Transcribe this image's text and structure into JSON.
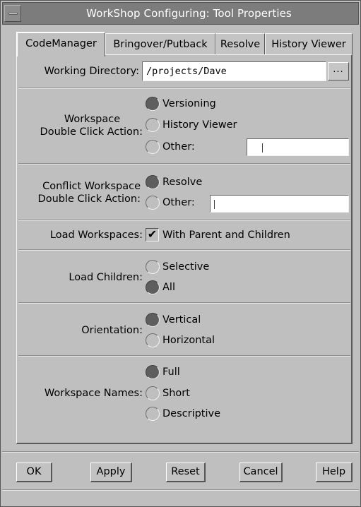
{
  "window": {
    "title": "WorkShop Configuring: Tool Properties"
  },
  "tabs": [
    {
      "label": "CodeManager",
      "active": true
    },
    {
      "label": "Bringover/Putback",
      "active": false
    },
    {
      "label": "Resolve",
      "active": false
    },
    {
      "label": "History Viewer",
      "active": false
    }
  ],
  "working_directory": {
    "label": "Working Directory:",
    "value": "/projects/Dave",
    "browse_label": "..."
  },
  "workspace_double_click": {
    "label_line1": "Workspace",
    "label_line2": "Double Click Action:",
    "options": [
      {
        "label": "Versioning",
        "selected": true
      },
      {
        "label": "History Viewer",
        "selected": false
      },
      {
        "label": "Other:",
        "selected": false
      }
    ],
    "other_value": ""
  },
  "conflict_double_click": {
    "label_line1": "Conflict Workspace",
    "label_line2": "Double Click Action:",
    "options": [
      {
        "label": "Resolve",
        "selected": true
      },
      {
        "label": "Other:",
        "selected": false
      }
    ],
    "other_value": ""
  },
  "load_workspaces": {
    "label": "Load Workspaces:",
    "option_label": "With Parent and Children",
    "checked": true,
    "check_glyph": "✔"
  },
  "load_children": {
    "label": "Load Children:",
    "options": [
      {
        "label": "Selective",
        "selected": false
      },
      {
        "label": "All",
        "selected": true
      }
    ]
  },
  "orientation": {
    "label": "Orientation:",
    "options": [
      {
        "label": "Vertical",
        "selected": true
      },
      {
        "label": "Horizontal",
        "selected": false
      }
    ]
  },
  "workspace_names": {
    "label": "Workspace Names:",
    "options": [
      {
        "label": "Full",
        "selected": true
      },
      {
        "label": "Short",
        "selected": false
      },
      {
        "label": "Descriptive",
        "selected": false
      }
    ]
  },
  "buttons": {
    "ok": "OK",
    "apply": "Apply",
    "reset": "Reset",
    "cancel": "Cancel",
    "help": "Help"
  },
  "colors": {
    "window_bg": "#bfbfbf",
    "titlebar_bg": "#7c7c7c",
    "radio_selected": "#5e5e5e"
  }
}
